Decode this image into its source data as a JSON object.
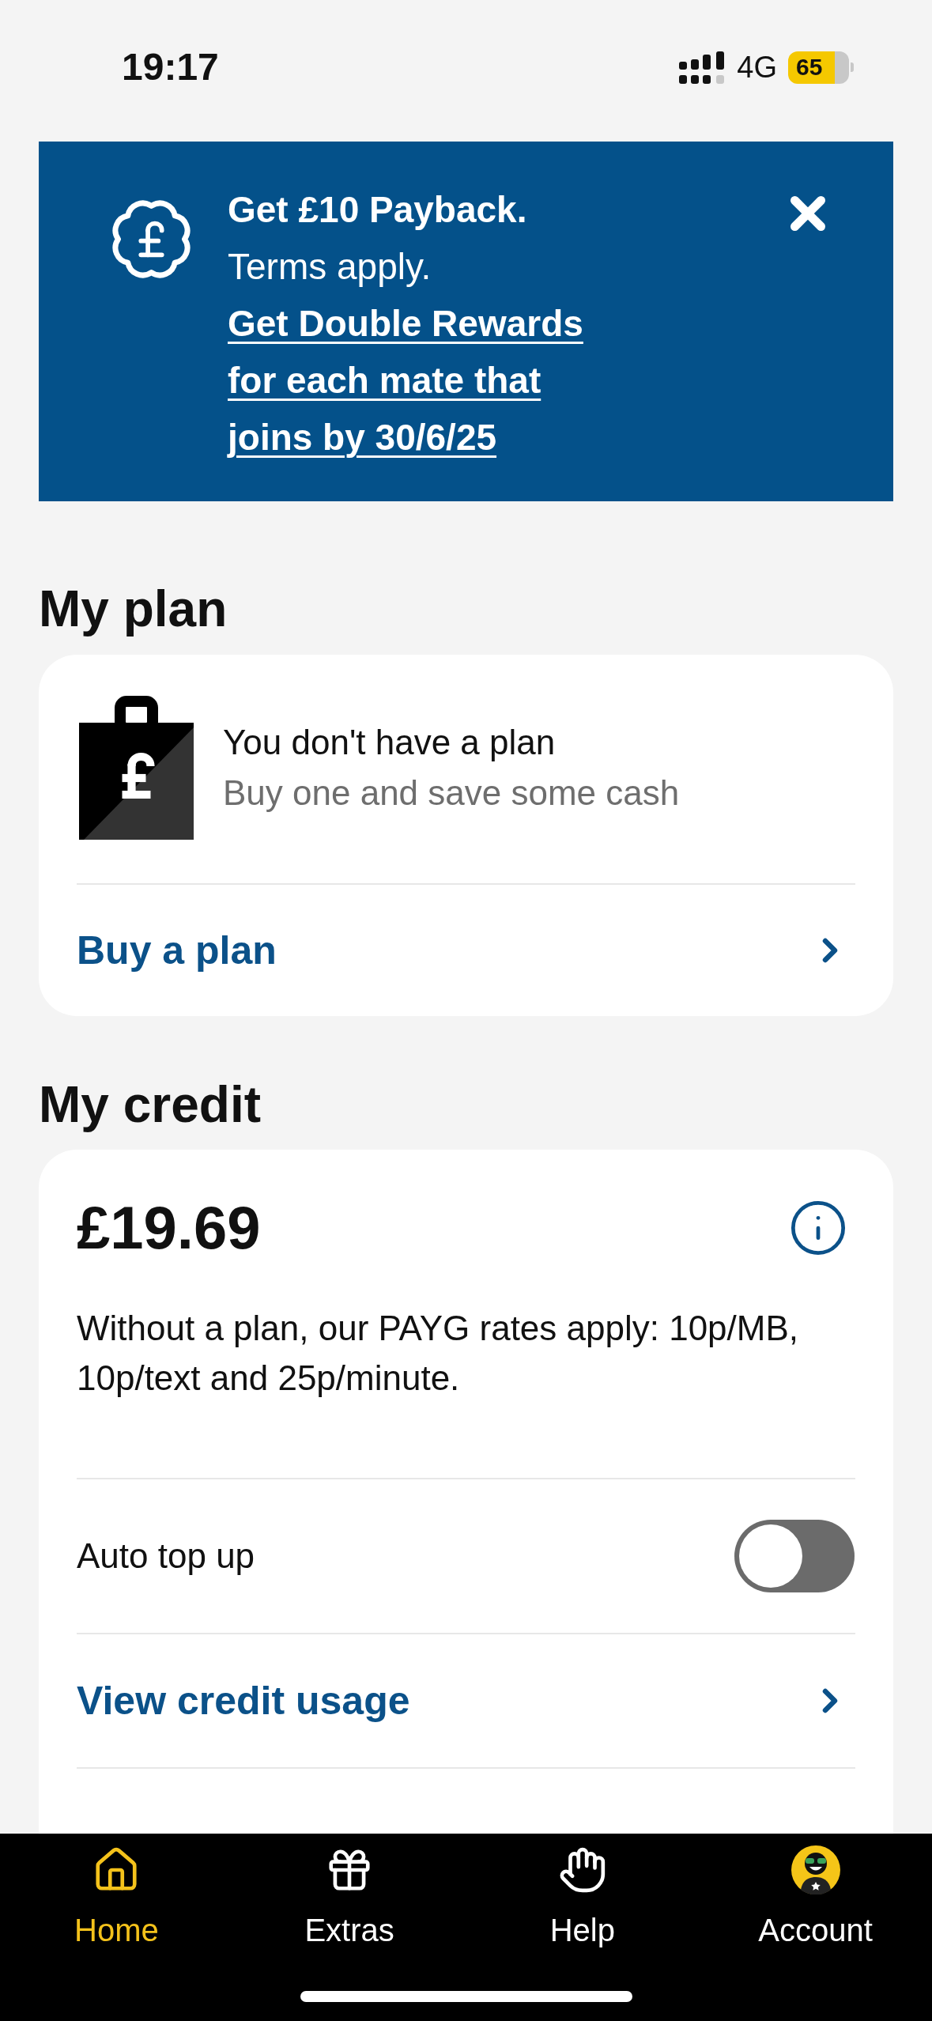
{
  "status_bar": {
    "time": "19:17",
    "network": "4G",
    "battery": "65"
  },
  "promo_banner": {
    "title": "Get £10 Payback.",
    "subtitle": "Terms apply.",
    "link": "Get Double Rewards for each mate that joins by 30/6/25"
  },
  "my_plan": {
    "heading": "My plan",
    "title": "You don't have a plan",
    "subtitle": "Buy one and save some cash",
    "action": "Buy a plan"
  },
  "my_credit": {
    "heading": "My credit",
    "balance": "£19.69",
    "description": "Without a plan, our PAYG rates apply: 10p/MB, 10p/text and 25p/minute.",
    "rows": [
      {
        "kind": "toggle",
        "label": "Auto top up",
        "on": false
      },
      {
        "kind": "link",
        "label": "View credit usage"
      }
    ]
  },
  "tab_bar": [
    {
      "label": "Home",
      "selected": true
    },
    {
      "label": "Extras",
      "selected": false
    },
    {
      "label": "Help",
      "selected": false
    },
    {
      "label": "Account",
      "selected": false
    }
  ]
}
